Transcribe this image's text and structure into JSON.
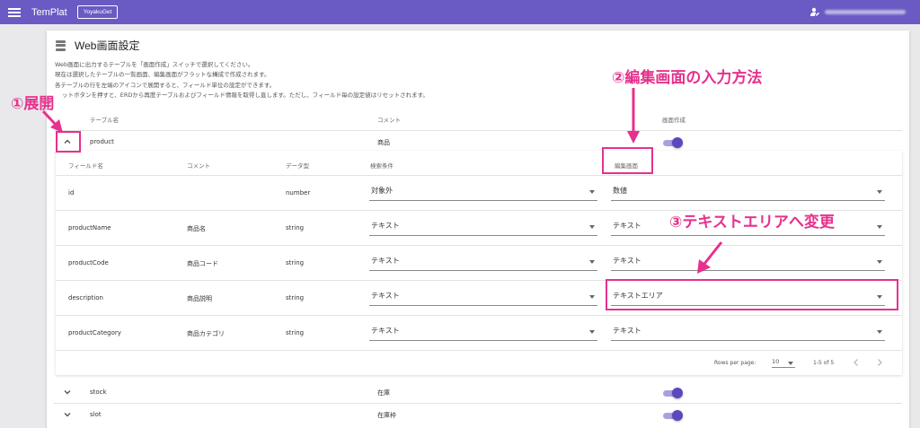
{
  "appbar": {
    "title": "TemPlat",
    "project_button": "YoyakuGet",
    "menu_icon": "menu-icon",
    "user_icon": "user-edit-icon"
  },
  "card": {
    "title": "Web画面設定",
    "title_icon": "database-icon",
    "description": [
      "Web画面に出力するテーブルを「画面作成」スイッチで選択してください。",
      "現在は選択したテーブルの一覧画面、編集画面がフラットな構成で作成されます。",
      "各テーブルの行を左端のアイコンで展開すると、フィールド単位の設定ができます。",
      "ットボタンを押すと、ERDから再度テーブルおよびフィールド情報を取得し直します。ただし、フィールド毎の設定値はリセットされます。"
    ]
  },
  "outer_table": {
    "headers": [
      "テーブル名",
      "コメント",
      "画面作成"
    ],
    "rows": [
      {
        "name": "product",
        "comment": "商品",
        "expanded": true,
        "create": true
      },
      {
        "name": "stock",
        "comment": "在庫",
        "expanded": false,
        "create": true
      },
      {
        "name": "slot",
        "comment": "在庫枠",
        "expanded": false,
        "create": true
      }
    ]
  },
  "inner_table": {
    "headers": [
      "フィールド名",
      "コメント",
      "データ型",
      "検索条件",
      "編集画面"
    ],
    "rows": [
      {
        "field": "id",
        "comment": "",
        "type": "number",
        "search": "対象外",
        "edit": "数値"
      },
      {
        "field": "productName",
        "comment": "商品名",
        "type": "string",
        "search": "テキスト",
        "edit": "テキスト"
      },
      {
        "field": "productCode",
        "comment": "商品コード",
        "type": "string",
        "search": "テキスト",
        "edit": "テキスト"
      },
      {
        "field": "description",
        "comment": "商品説明",
        "type": "string",
        "search": "テキスト",
        "edit": "テキストエリア"
      },
      {
        "field": "productCategory",
        "comment": "商品カテゴリ",
        "type": "string",
        "search": "テキスト",
        "edit": "テキスト"
      }
    ],
    "footer": {
      "rows_per_page_label": "Rows per page:",
      "rows_per_page_value": "10",
      "range": "1-5 of 5"
    }
  },
  "annotations": {
    "expand": "①展開",
    "edit_input": "②編集画面の入力方法",
    "change_textarea": "③テキストエリアへ変更",
    "color": "#e6318d"
  },
  "colors": {
    "appbar": "#6a5ac3",
    "toggle_knob": "#5a48bf",
    "toggle_track": "#a9a0e2",
    "background": "#e9e9ec"
  }
}
